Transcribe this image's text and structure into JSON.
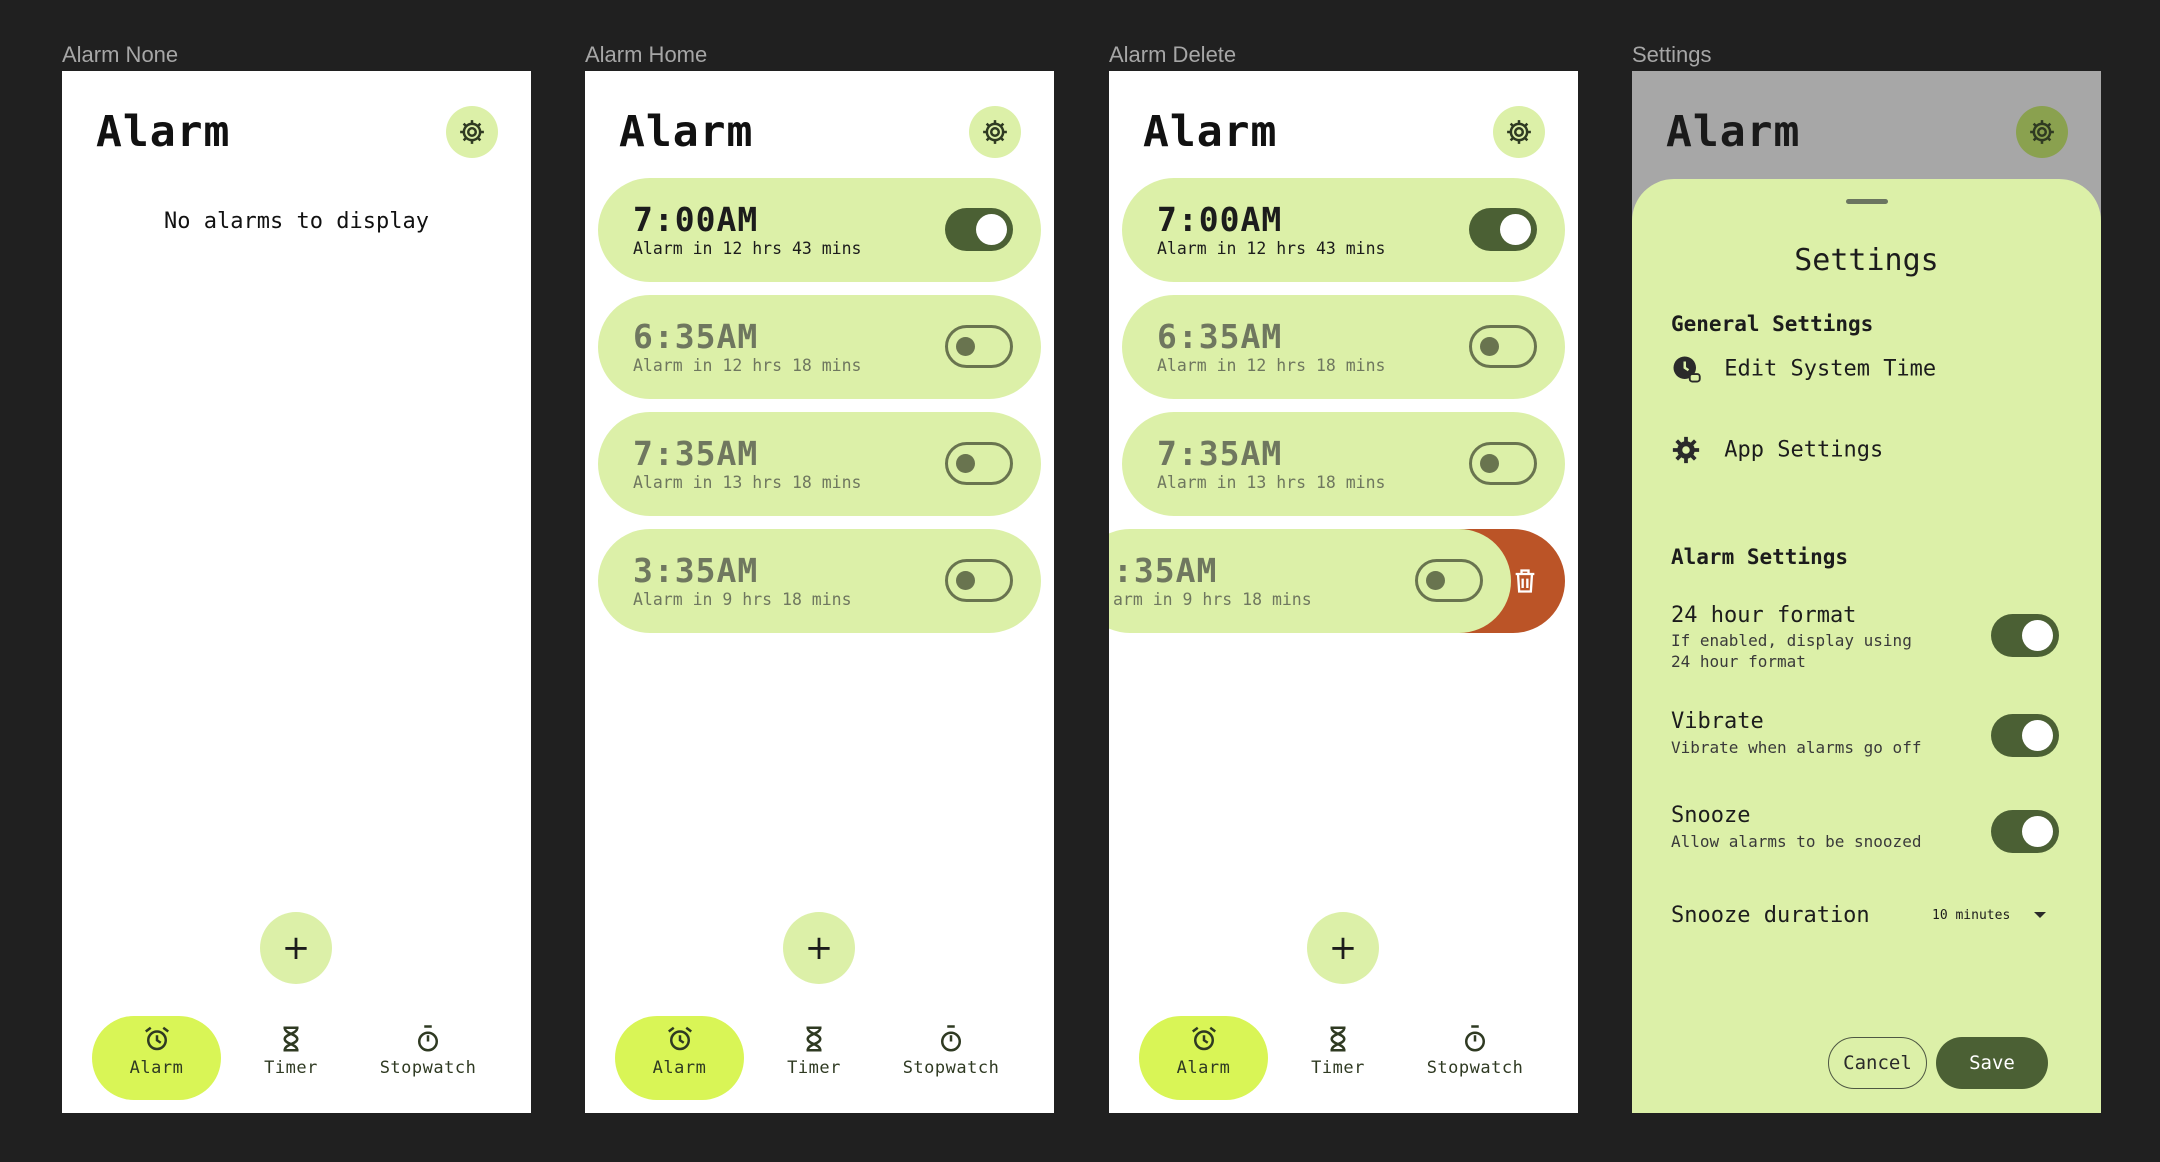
{
  "frames": [
    "Alarm None",
    "Alarm Home",
    "Alarm Delete",
    "Settings"
  ],
  "app": {
    "title": "Alarm",
    "add_label": "+"
  },
  "empty_message": "No alarms to display",
  "nav": {
    "alarm": "Alarm",
    "timer": "Timer",
    "stopwatch": "Stopwatch"
  },
  "alarms": [
    {
      "time": "7:00AM",
      "sub": "Alarm in 12 hrs 43 mins",
      "enabled": true
    },
    {
      "time": "6:35AM",
      "sub": "Alarm in 12 hrs 18 mins",
      "enabled": false
    },
    {
      "time": "7:35AM",
      "sub": "Alarm in 13 hrs 18 mins",
      "enabled": false
    },
    {
      "time": "3:35AM",
      "sub": "Alarm in 9 hrs 18 mins",
      "enabled": false
    }
  ],
  "swiped_alarm": {
    "time": ":35AM",
    "sub": "arm in 9 hrs 18 mins"
  },
  "settings": {
    "title": "Settings",
    "general_header": "General Settings",
    "edit_time": "Edit System Time",
    "app_settings": "App Settings",
    "alarm_header": "Alarm Settings",
    "hour24_title": "24 hour format",
    "hour24_sub_1": "If enabled, display using",
    "hour24_sub_2": "24 hour format",
    "vibrate_title": "Vibrate",
    "vibrate_sub": "Vibrate when alarms go off",
    "snooze_title": "Snooze",
    "snooze_sub": "Allow alarms to be snoozed",
    "snooze_duration_label": "Snooze duration",
    "snooze_duration_value": "10 minutes",
    "toggles": {
      "hour24": true,
      "vibrate": true,
      "snooze": true
    },
    "cancel": "Cancel",
    "save": "Save"
  },
  "colors": {
    "background": "#202020",
    "card": "#dcf0a8",
    "accent": "#d9f556",
    "toggle_on": "#4b6034",
    "delete": "#bb5427",
    "scrim": "#a7a7a7"
  }
}
